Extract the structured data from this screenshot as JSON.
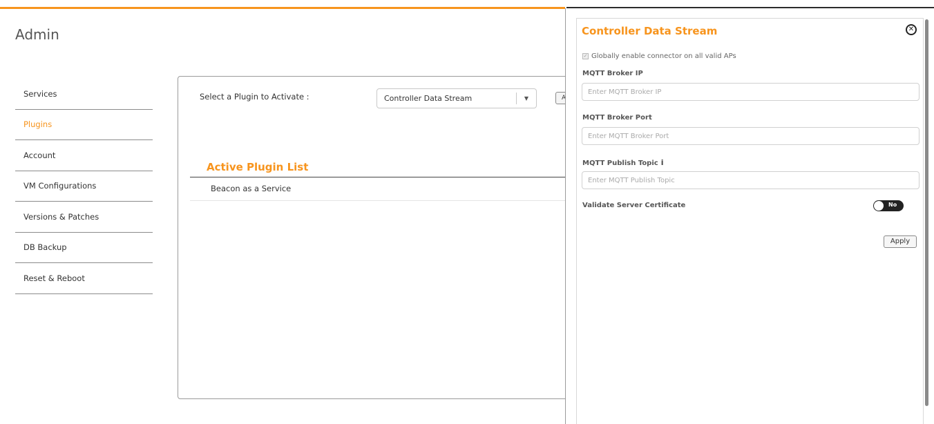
{
  "header": {
    "title": "Admin"
  },
  "colors": {
    "accent": "#f7941d",
    "border": "#9a9a9a"
  },
  "sidebar": {
    "items": [
      {
        "label": "Services"
      },
      {
        "label": "Plugins"
      },
      {
        "label": "Account"
      },
      {
        "label": "VM Configurations"
      },
      {
        "label": "Versions & Patches"
      },
      {
        "label": "DB Backup"
      },
      {
        "label": "Reset & Reboot"
      }
    ]
  },
  "main": {
    "select_label": "Select a Plugin to Activate :",
    "selected_plugin": "Controller Data Stream",
    "activate_button": "A",
    "active_plugin_list_title": "Active Plugin List",
    "active_plugins": [
      "Beacon as a Service"
    ]
  },
  "drawer": {
    "title": "Controller Data Stream",
    "close_icon": "close-circle-icon",
    "checkbox_label": "Globally enable connector on all valid APs",
    "fields": {
      "broker_ip": {
        "label": "MQTT Broker IP",
        "placeholder": "Enter MQTT Broker IP",
        "value": ""
      },
      "broker_port": {
        "label": "MQTT Broker Port",
        "placeholder": "Enter MQTT Broker Port",
        "value": ""
      },
      "publish_topic": {
        "label": "MQTT Publish Topic",
        "info_icon": "i",
        "placeholder": "Enter MQTT Publish Topic",
        "value": ""
      }
    },
    "validate_cert_label": "Validate Server Certificate",
    "toggle_text": "No",
    "apply_button": "Apply"
  }
}
